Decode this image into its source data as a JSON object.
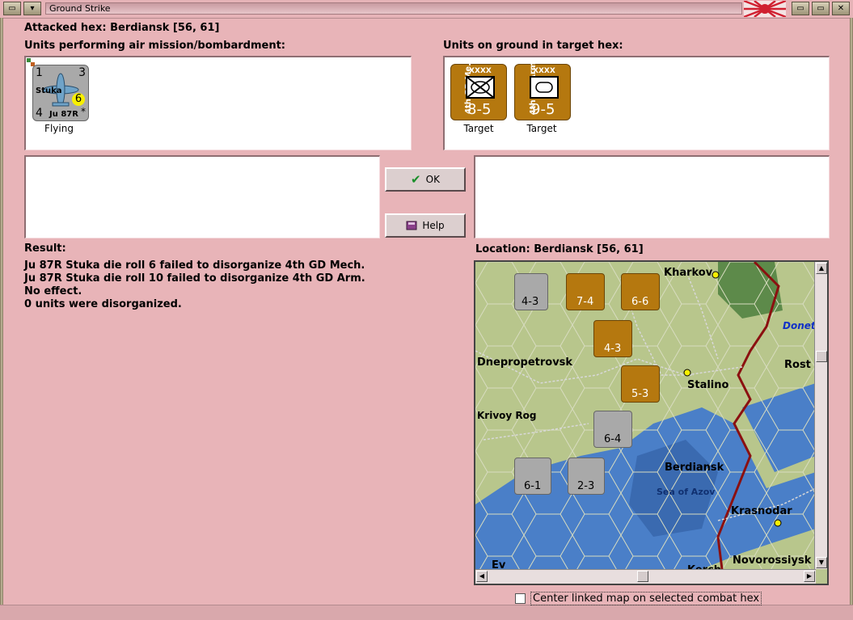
{
  "window": {
    "title": "Ground Strike"
  },
  "header": {
    "attacked_hex": "Attacked hex: Berdiansk  [56, 61]"
  },
  "air_panel": {
    "label": "Units performing air mission/bombardment:",
    "units": [
      {
        "name": "Stuka",
        "type": "Ju 87R",
        "top_left": "1",
        "top_right": "3",
        "bottom_left": "4",
        "strength": "6",
        "mark": "*",
        "status": "Flying"
      }
    ]
  },
  "ground_panel": {
    "label": "Units on ground in target hex:",
    "units": [
      {
        "side_name": "4th GD Me.",
        "size": "XXXX",
        "values": "8-5",
        "status": "Target",
        "symbol": "mech"
      },
      {
        "side_name": "4th GD Arm",
        "size": "XXXX",
        "values": "9-5",
        "status": "Target",
        "symbol": "armor"
      }
    ]
  },
  "buttons": {
    "ok": "OK",
    "help": "Help"
  },
  "result": {
    "label": "Result:",
    "lines": [
      "Ju 87R Stuka die roll 6 failed to disorganize 4th GD Mech.",
      "Ju 87R Stuka die roll 10 failed to disorganize 4th GD Arm.",
      "No effect.",
      "0 units were disorganized."
    ]
  },
  "location": {
    "label": "Location:  Berdiansk  [56, 61]",
    "map_labels": {
      "kharkov": "Kharkov",
      "donets": "Donets",
      "dnepropetrovsk": "Dnepropetrovsk",
      "stalino": "Stalino",
      "krivoy_rog": "Krivoy Rog",
      "berdiansk": "Berdiansk",
      "sea_of_azov": "Sea of Azov",
      "krasnodar": "Krasnodar",
      "novorossiysk": "Novorossiysk",
      "kerch": "Kerch",
      "rostov_partial": "Rost",
      "evp_partial": "Ev"
    },
    "map_counters": [
      {
        "values": "4-3"
      },
      {
        "values": "7-4"
      },
      {
        "values": "6-6"
      },
      {
        "values": "4-3"
      },
      {
        "values": "5-3"
      },
      {
        "values": "6-4"
      },
      {
        "values": "6-1"
      },
      {
        "values": "2-3"
      }
    ]
  },
  "center_checkbox": {
    "label": "Center linked map on selected combat hex",
    "checked": false
  },
  "colors": {
    "background": "#e8b4b8",
    "gd_counter": "#b5780f",
    "air_counter": "#a9a9a9",
    "sea": "#4a7fc8",
    "front_line": "#8b1010"
  }
}
